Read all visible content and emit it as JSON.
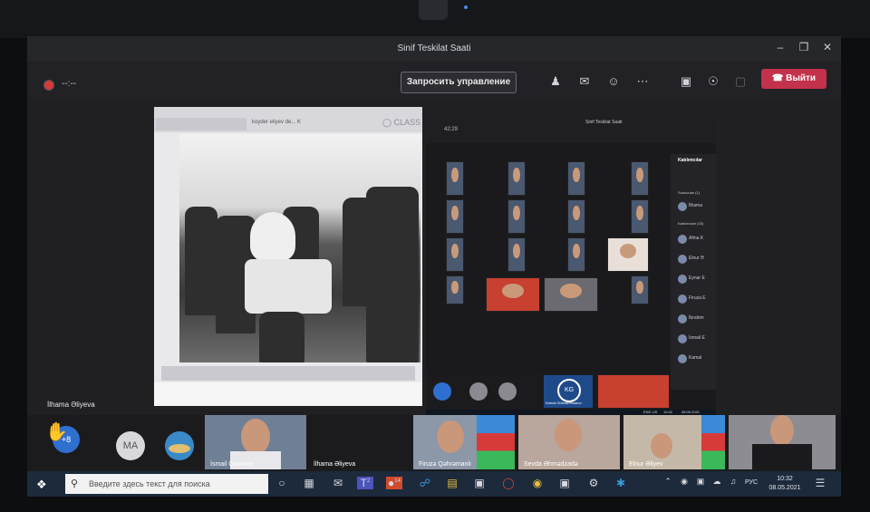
{
  "app": {
    "window_title": "Sinif Teskilat Saati",
    "timer": "--:--"
  },
  "toolbar": {
    "request_control_label": "Запросить управление",
    "leave_label": "Выйти"
  },
  "shared": {
    "header_text": "koyder eliyev de... K",
    "logo_text": "CLASS",
    "presenter_name": "İlhama Əliyeva"
  },
  "nested": {
    "title": "Sinif Teskilat Saati",
    "timer": "42:29",
    "sidebar_title": "Katılımcılar",
    "section_1": "Sunucular (1)",
    "section_2": "Katılımcılar (15)",
    "entries": [
      "İlhama",
      "Afina K",
      "Elnur Ə",
      "Eynar E",
      "Firuza E",
      "İbrahim",
      "İsmail E",
      "Kamal"
    ],
    "speaker_initials": "KG",
    "speaker_name": "Kamal Gülmammadov",
    "tray_lang": "ENG US",
    "tray_time": "10:42",
    "tray_date": "08.05.2021"
  },
  "strip": {
    "hand_count": "+8",
    "ma_initials": "MA",
    "tiles": [
      {
        "name": "İsmail Qasımov",
        "color": "#6f7f95"
      },
      {
        "name": "İlhama Əliyeva",
        "color": "#1b1b1e"
      },
      {
        "name": "Firuzə Qəhrəmanlı",
        "color": "#8c97a8"
      },
      {
        "name": "Sevda Əhmədzadə",
        "color": "#b9a69c"
      },
      {
        "name": "Elnur Əliyev",
        "color": "#c4b9a8"
      },
      {
        "name": "",
        "color": "#8c8c92"
      }
    ]
  },
  "taskbar": {
    "search_placeholder": "Введите здесь текст для поиска",
    "lang": "РУС",
    "time": "10:32",
    "date": "08.05.2021",
    "badge_1": "2",
    "badge_2": "14"
  }
}
